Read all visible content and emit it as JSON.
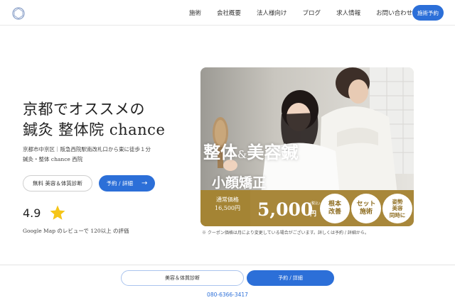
{
  "header": {
    "nav": [
      "施術",
      "会社概要",
      "法人様向け",
      "ブログ",
      "求人情報",
      "お問い合わせ"
    ],
    "cta": "施術予約"
  },
  "hero": {
    "title_line1": "京都でオススメの",
    "title_line2": "鍼灸 整体院 chance",
    "sub_line1": "京都市中京区｜阪急西院駅南改札口から東に徒歩１分",
    "sub_line2": "鍼灸・整体 chance 西院",
    "btn_diagnosis": "無料 美容＆体質診断",
    "btn_reserve": "予約 / 詳細",
    "rating": "4.9",
    "review_text": "Google Map のレビューで 120以上 の評価"
  },
  "promo": {
    "headline_a": "整体",
    "headline_amp": "&",
    "headline_b": "美容鍼",
    "headline_2": "小顔矯正",
    "regular_label": "通常価格",
    "regular_price": "16,500円",
    "price": "5,000",
    "tax_note": "(税込)",
    "yen": "円",
    "badges": [
      [
        "根本",
        "改善"
      ],
      [
        "セット",
        "施術"
      ],
      [
        "姿勢",
        "美容",
        "同時に"
      ]
    ],
    "coupon_note": "※ クーポン価格は月により変更している場合がございます。詳しくは予約 / 詳細から。"
  },
  "footer": {
    "btn_diagnosis": "美容＆体質診断",
    "btn_reserve": "予約 / 詳細",
    "phone": "080-6366-3417"
  },
  "colors": {
    "accent": "#2c6fd8",
    "gold": "#a8873a",
    "star": "#f5c518"
  },
  "icons": [
    "logo-icon",
    "star-icon",
    "arrow-right-icon"
  ]
}
